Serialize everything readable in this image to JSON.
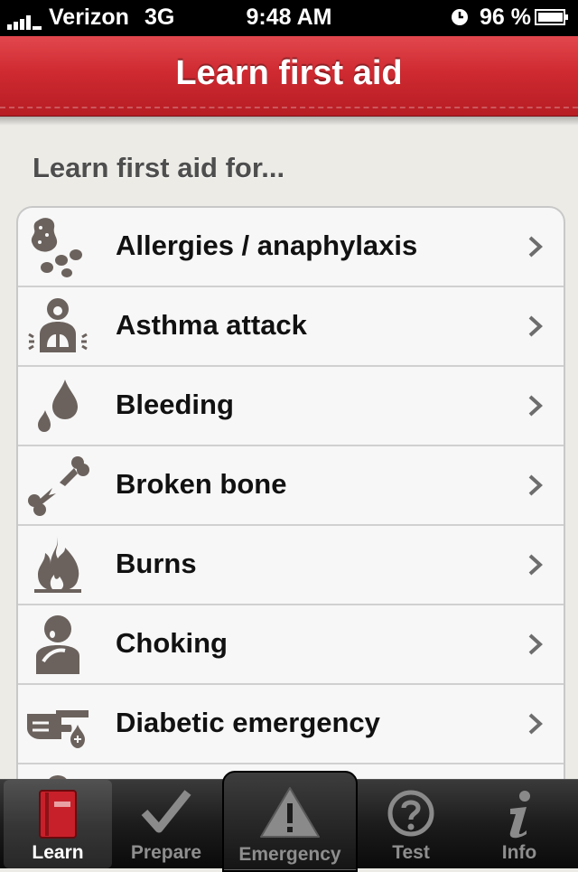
{
  "status_bar": {
    "carrier": "Verizon",
    "network": "3G",
    "time": "9:48 AM",
    "battery": "96 %"
  },
  "nav": {
    "title": "Learn first aid"
  },
  "section_label": "Learn first aid for...",
  "items": [
    {
      "label": "Allergies / anaphylaxis",
      "icon": "peanut-icon"
    },
    {
      "label": "Asthma attack",
      "icon": "lungs-icon"
    },
    {
      "label": "Bleeding",
      "icon": "blood-drop-icon"
    },
    {
      "label": "Broken bone",
      "icon": "broken-bone-icon"
    },
    {
      "label": "Burns",
      "icon": "fire-icon"
    },
    {
      "label": "Choking",
      "icon": "choking-icon"
    },
    {
      "label": "Diabetic emergency",
      "icon": "diabetes-icon"
    }
  ],
  "tabs": [
    {
      "label": "Learn",
      "icon": "book-icon",
      "active": true
    },
    {
      "label": "Prepare",
      "icon": "checkmark-icon",
      "active": false
    },
    {
      "label": "Emergency",
      "icon": "warning-icon",
      "active": false
    },
    {
      "label": "Test",
      "icon": "question-icon",
      "active": false
    },
    {
      "label": "Info",
      "icon": "info-icon",
      "active": false
    }
  ],
  "colors": {
    "accent": "#cf2a31",
    "icon_gray": "#6b625d",
    "tab_bg": "#1c1c1c"
  }
}
